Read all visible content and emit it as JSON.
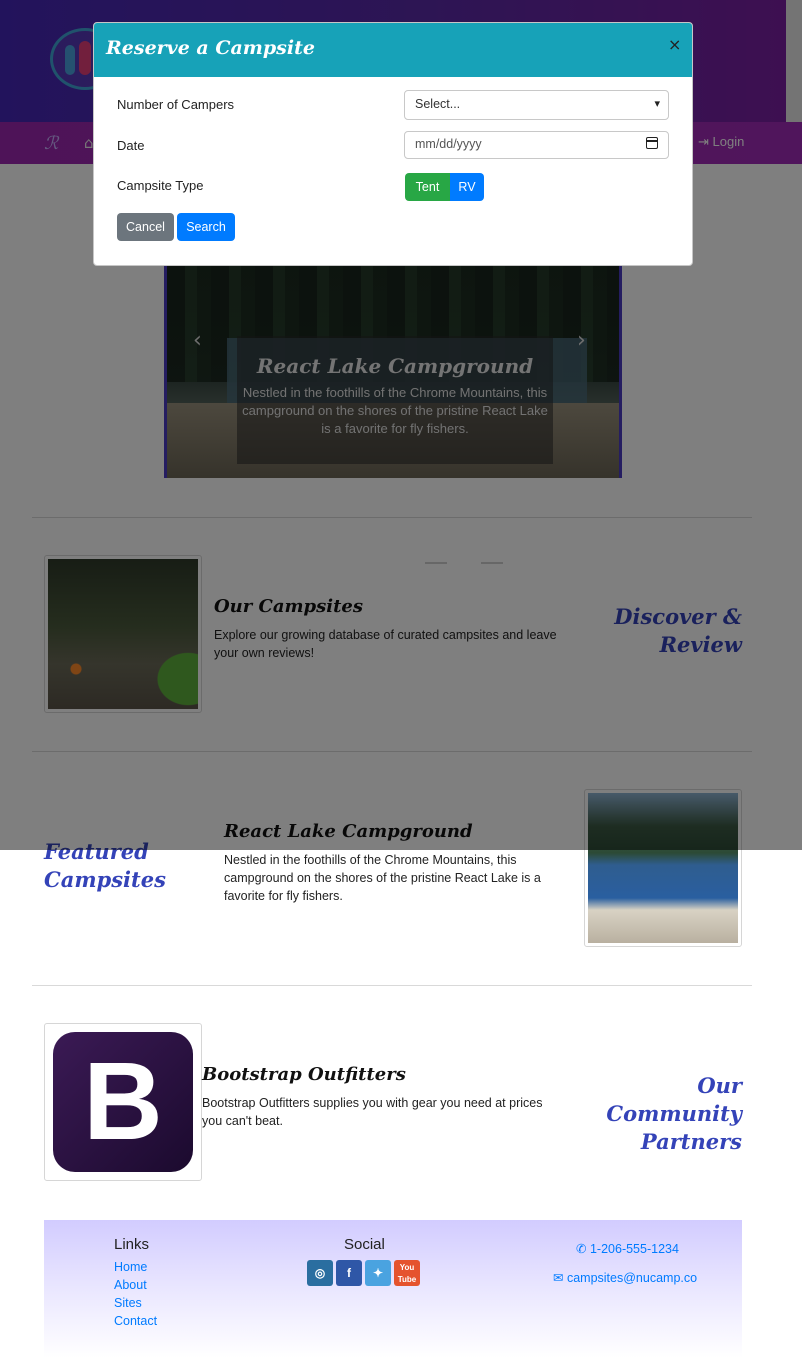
{
  "nav": {
    "home_icon": "home-icon",
    "login_label": "Login",
    "login_icon": "sign-in-icon"
  },
  "carousel": {
    "title": "React Lake Campground",
    "text": "Nestled in the foothills of the Chrome Mountains, this campground on the shores of the pristine React Lake is a favorite for fly fishers.",
    "prev_icon": "chevron-left-icon",
    "next_icon": "chevron-right-icon",
    "slides_total": 3,
    "active_slide": 2
  },
  "sections": {
    "campsites": {
      "title": "Our Campsites",
      "text": "Explore our growing database of curated campsites and leave your own reviews!",
      "side_line1": "Discover &",
      "side_line2": "Review"
    },
    "featured": {
      "title": "React Lake Campground",
      "text": "Nestled in the foothills of the Chrome Mountains, this campground on the shores of the pristine React Lake is a favorite for fly fishers.",
      "side_line1": "Featured",
      "side_line2": "Campsites"
    },
    "partners": {
      "title": "Bootstrap Outfitters",
      "text": "Bootstrap Outfitters supplies you with gear you need at prices you can't beat.",
      "logo_letter": "B",
      "side_line1": "Our Community",
      "side_line2": "Partners"
    }
  },
  "modal": {
    "title": "Reserve a Campsite",
    "close": "×",
    "campers_label": "Number of Campers",
    "campers_value": "Select...",
    "date_label": "Date",
    "date_placeholder": "mm/dd/yyyy",
    "type_label": "Campsite Type",
    "tent": "Tent",
    "rv": "RV",
    "cancel": "Cancel",
    "search": "Search"
  },
  "footer": {
    "links_head": "Links",
    "links": [
      "Home",
      "About",
      "Sites",
      "Contact"
    ],
    "social_head": "Social",
    "social_icons": [
      "instagram-icon",
      "facebook-icon",
      "twitter-icon",
      "youtube-icon"
    ],
    "phone": "1-206-555-1234",
    "email": "campsites@nucamp.co"
  },
  "colors": {
    "modal_header": "#17a2b8",
    "tent_button": "#28a745",
    "primary": "#007bff",
    "secondary": "#6c757d",
    "accent_heading": "#3443b8"
  }
}
